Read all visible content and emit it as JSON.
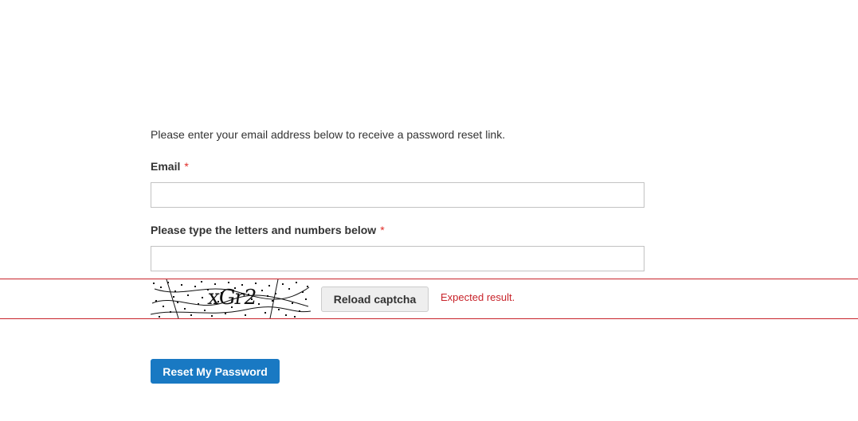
{
  "form": {
    "intro_text": "Please enter your email address below to receive a password reset link.",
    "email": {
      "label": "Email",
      "required_marker": "*",
      "value": "",
      "placeholder": ""
    },
    "captcha": {
      "label": "Please type the letters and numbers below",
      "required_marker": "*",
      "value": "",
      "placeholder": "",
      "image_text": "xGr2",
      "reload_label": "Reload captcha",
      "result_message": "Expected result."
    },
    "submit_label": "Reset My Password"
  },
  "colors": {
    "primary_button": "#1979c3",
    "required_marker": "#e02b27",
    "highlight_line": "#c8232a",
    "result_message": "#c8232a"
  }
}
